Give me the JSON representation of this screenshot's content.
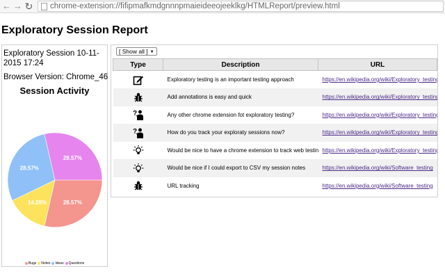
{
  "browser": {
    "url": "chrome-extension://fifipmafkmdgnnnpmaieideeojeeklkg/HTMLReport/preview.html"
  },
  "report": {
    "title": "Exploratory Session Report",
    "session_name": "Exploratory Session 10-11-2015 17:24",
    "browser_version": "Browser Version: Chrome_46",
    "activity_title": "Session Activity"
  },
  "filter": {
    "selected": "[ Show all ]"
  },
  "table": {
    "headers": {
      "type": "Type",
      "description": "Description",
      "url": "URL"
    },
    "rows": [
      {
        "type": "note",
        "type_icon": "note-edit-icon",
        "description": "Exploratory testing is an important testing approach",
        "url": "https://en.wikipedia.org/wiki/Exploratory_testing"
      },
      {
        "type": "bug",
        "type_icon": "bug-icon",
        "description": "Add annotations is easy and quick",
        "url": "https://en.wikipedia.org/wiki/Exploratory_testing"
      },
      {
        "type": "question",
        "type_icon": "question-person-icon",
        "description": "Any other chrome extension fot exploratory testing?",
        "url": "https://en.wikipedia.org/wiki/Exploratory_testing"
      },
      {
        "type": "question",
        "type_icon": "question-person-icon",
        "description": "How do you track your exploraty sessions now?",
        "url": "https://en.wikipedia.org/wiki/Exploratory_testing"
      },
      {
        "type": "idea",
        "type_icon": "lightbulb-icon",
        "description": "Would be nice to have a chrome extension to track web testing",
        "url": "https://en.wikipedia.org/wiki/Exploratory_testing"
      },
      {
        "type": "idea",
        "type_icon": "lightbulb-icon",
        "description": "Would be nice if I could export to CSV my session notes",
        "url": "https://en.wikipedia.org/wiki/Software_testing"
      },
      {
        "type": "bug",
        "type_icon": "bug-icon",
        "description": "URL tracking",
        "url": "https://en.wikipedia.org/wiki/Software_testing"
      }
    ]
  },
  "chart_data": {
    "type": "pie",
    "title": "Session Activity",
    "slices": [
      {
        "name": "Bugs",
        "value": 28.57,
        "label": "28.57%",
        "color": "#f4958e"
      },
      {
        "name": "Notes",
        "value": 14.29,
        "label": "14.29%",
        "color": "#fde35d"
      },
      {
        "name": "Ideas",
        "value": 28.57,
        "label": "28.57%",
        "color": "#8fc0f7"
      },
      {
        "name": "Questions",
        "value": 28.57,
        "label": "28.57%",
        "color": "#e685ee"
      }
    ],
    "legend_position": "bottom"
  }
}
